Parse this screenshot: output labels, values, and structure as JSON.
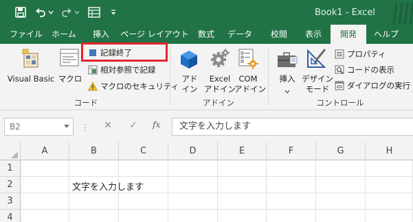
{
  "window": {
    "title": "Book1  -  Excel"
  },
  "colors": {
    "accent": "#217346",
    "highlight": "#e4232b"
  },
  "qat": {
    "icons": [
      "save-icon",
      "undo-icon",
      "undo-dropdown-icon",
      "redo-icon",
      "redo-dropdown-icon",
      "form-icon",
      "customize-qat-icon"
    ]
  },
  "tabs": [
    {
      "label": "ファイル"
    },
    {
      "label": "ホーム"
    },
    {
      "label": "挿入"
    },
    {
      "label": "ページ レイアウト"
    },
    {
      "label": "数式"
    },
    {
      "label": "データ"
    },
    {
      "label": "校閲"
    },
    {
      "label": "表示"
    },
    {
      "label": "開発"
    },
    {
      "label": "ヘルプ"
    }
  ],
  "active_tab": "開発",
  "ribbon": {
    "code": {
      "visual_basic": "Visual Basic",
      "macro": "マクロ",
      "record_macro": "記録終了",
      "relative_ref": "相対参照で記録",
      "macro_security": "マクロのセキュリティ",
      "group_label": "コード"
    },
    "addins": {
      "addin_line1": "アド",
      "addin_line2": "イン",
      "excel_addin_line1": "Excel",
      "excel_addin_line2": "アドイン",
      "com_addin_line1": "COM",
      "com_addin_line2": "アドイン",
      "group_label": "アドイン"
    },
    "controls": {
      "insert": "挿入",
      "design_mode_line1": "デザイン",
      "design_mode_line2": "モード",
      "properties": "プロパティ",
      "view_code": "コードの表示",
      "run_dialog": "ダイアログの実行",
      "group_label": "コントロール"
    }
  },
  "formula_bar": {
    "name_box": "B2",
    "fx_label": "fx",
    "cancel_symbol": "✕",
    "enter_symbol": "✓",
    "formula": "文字を入力します"
  },
  "sheet": {
    "columns": [
      "A",
      "B",
      "C",
      "D",
      "E",
      "F",
      "G",
      "H"
    ],
    "rows": [
      "1",
      "2",
      "3",
      "4"
    ],
    "cell_b2": "文字を入力します"
  }
}
